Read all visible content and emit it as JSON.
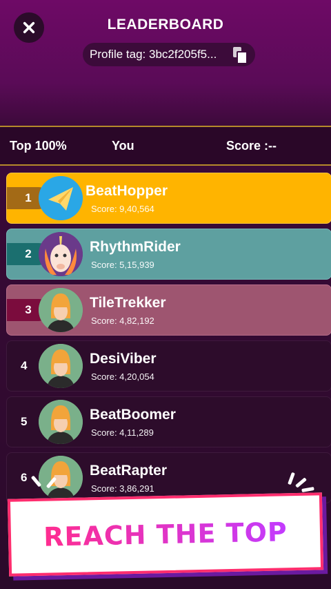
{
  "header": {
    "title": "LEADERBOARD",
    "profile_tag": "Profile tag: 3bc2f205f5...",
    "close_icon": "close-icon",
    "copy_icon": "copy-icon"
  },
  "table_header": {
    "rank_filter": "Top 100%",
    "you": "You",
    "score": "Score :--"
  },
  "rows": [
    {
      "rank": "1",
      "name": "BeatHopper",
      "score": "Score:  9,40,564",
      "avatar": "paper-plane-avatar"
    },
    {
      "rank": "2",
      "name": "RhythmRider",
      "score": "Score:  5,15,939",
      "avatar": "unicorn-avatar"
    },
    {
      "rank": "3",
      "name": "TileTrekker",
      "score": "Score:  4,82,192",
      "avatar": "default-avatar"
    },
    {
      "rank": "4",
      "name": "DesiViber",
      "score": "Score:  4,20,054",
      "avatar": "default-avatar"
    },
    {
      "rank": "5",
      "name": "BeatBoomer",
      "score": "Score:  4,11,289",
      "avatar": "default-avatar"
    },
    {
      "rank": "6",
      "name": "BeatRapter",
      "score": "Score:  3,86,291",
      "avatar": "default-avatar"
    }
  ],
  "banner": {
    "text": "REACH THE TOP"
  },
  "colors": {
    "gold": "#ffb400",
    "teal": "#5ea0a0",
    "rose": "#9e5570",
    "banner_text": "#ff2d8f"
  }
}
